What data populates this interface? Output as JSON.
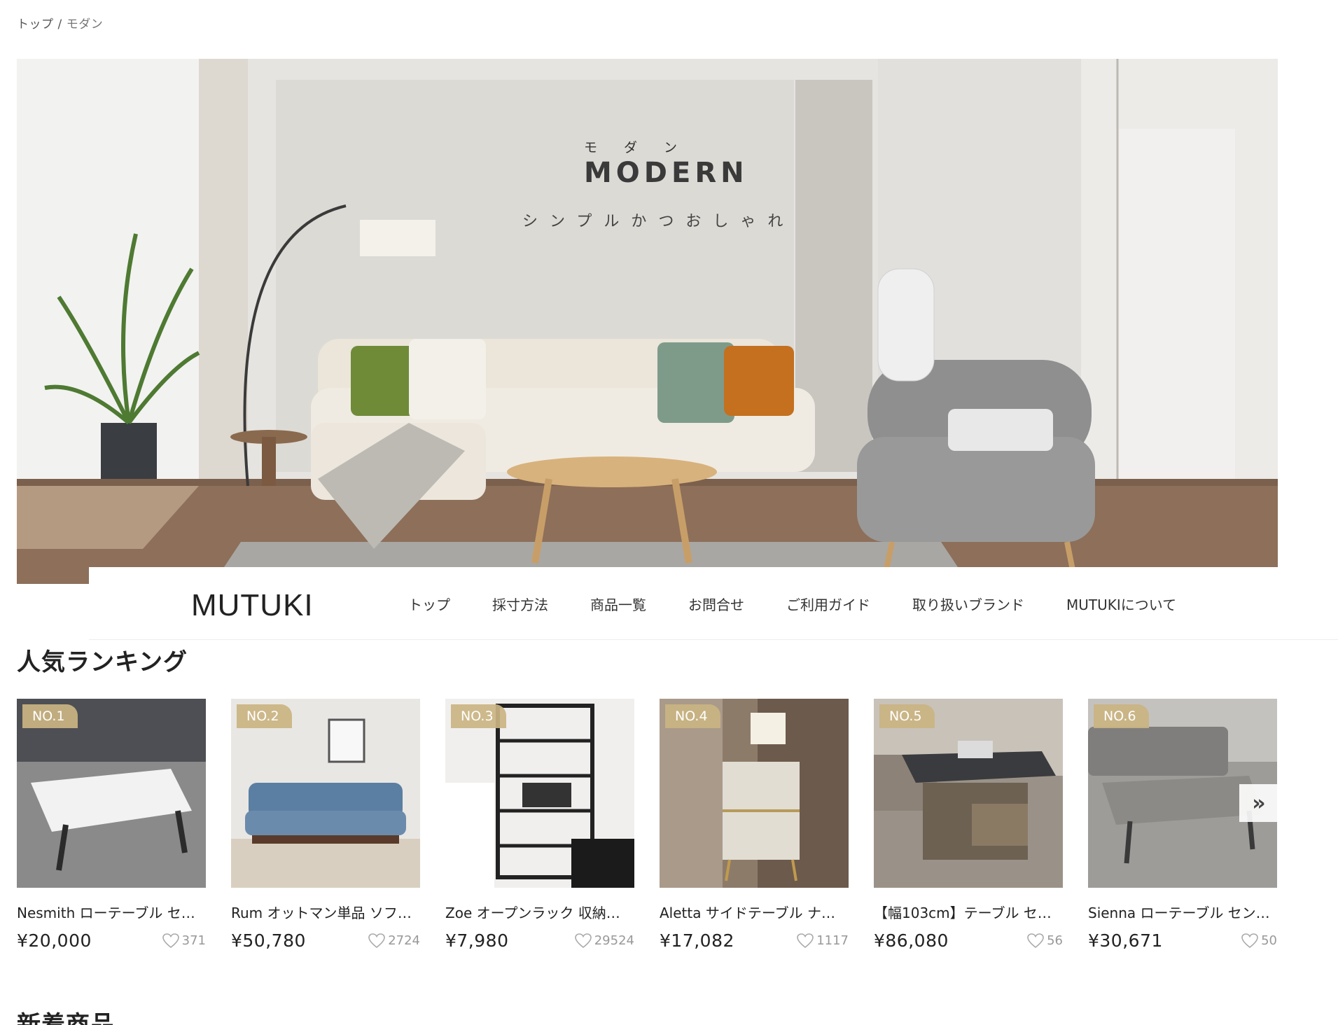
{
  "breadcrumb": {
    "home": "トップ",
    "separator": "/",
    "current": "モダン"
  },
  "hero": {
    "kana": "モダン",
    "title": "MODERN",
    "subtitle": "シンプルかつおしゃれ"
  },
  "nav": {
    "logo": "MUTUKI",
    "items": [
      "トップ",
      "採寸方法",
      "商品一覧",
      "お問合せ",
      "ご利用ガイド",
      "取り扱いブランド",
      "MUTUKIについて"
    ]
  },
  "ranking": {
    "title": "人気ランキング",
    "items": [
      {
        "badge": "NO.1",
        "name": "Nesmith ローテーブル セ…",
        "price": "¥20,000",
        "likes": "371"
      },
      {
        "badge": "NO.2",
        "name": "Rum オットマン単品 ソフ…",
        "price": "¥50,780",
        "likes": "2724"
      },
      {
        "badge": "NO.3",
        "name": "Zoe オープンラック 収納…",
        "price": "¥7,980",
        "likes": "29524"
      },
      {
        "badge": "NO.4",
        "name": "Aletta サイドテーブル ナ…",
        "price": "¥17,082",
        "likes": "1117"
      },
      {
        "badge": "NO.5",
        "name": "【幅103cm】テーブル セ…",
        "price": "¥86,080",
        "likes": "56"
      },
      {
        "badge": "NO.6",
        "name": "Sienna ローテーブル セン…",
        "price": "¥30,671",
        "likes": "50"
      }
    ],
    "next_icon": "double-chevron-right-icon"
  },
  "new_arrivals": {
    "title": "新着商品"
  }
}
